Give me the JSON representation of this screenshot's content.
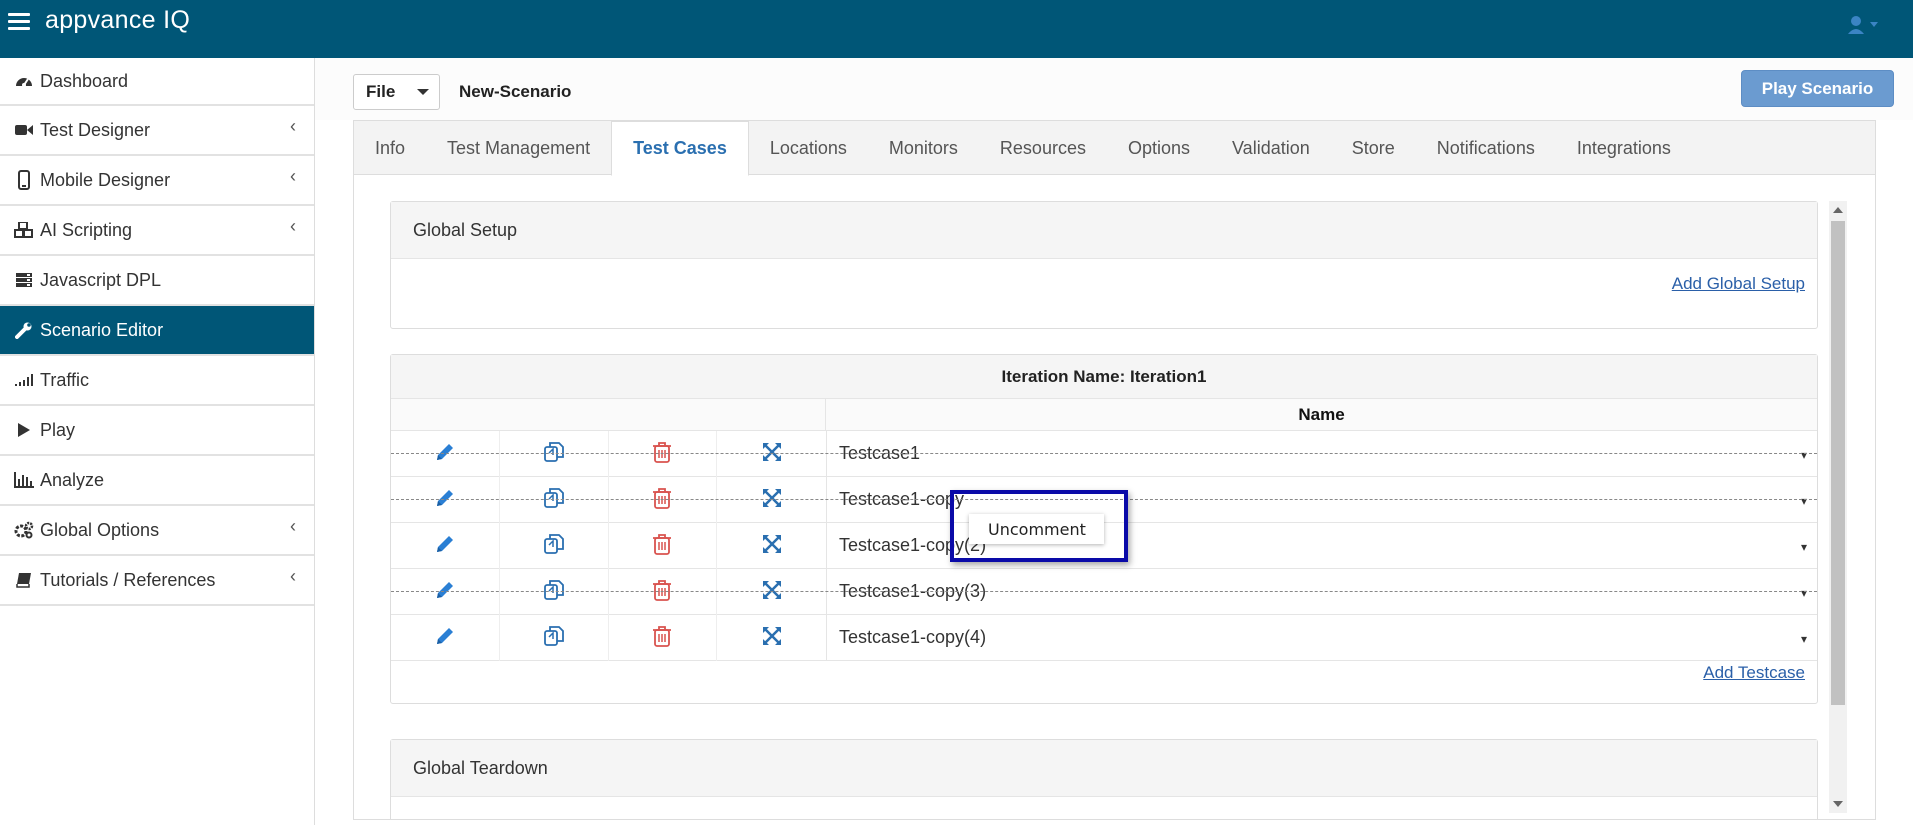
{
  "app": {
    "logo": "appvance IQ"
  },
  "sidebar": {
    "items": [
      {
        "label": "Dashboard",
        "icon": "dashboard-icon"
      },
      {
        "label": "Test Designer",
        "icon": "video-camera-icon",
        "chevron": "‹"
      },
      {
        "label": "Mobile Designer",
        "icon": "mobile-icon",
        "chevron": "‹"
      },
      {
        "label": "AI Scripting",
        "icon": "cubes-icon",
        "chevron": "‹"
      },
      {
        "label": "Javascript DPL",
        "icon": "server-icon"
      },
      {
        "label": "Scenario Editor",
        "icon": "wrench-icon",
        "active": true
      },
      {
        "label": "Traffic",
        "icon": "signal-icon"
      },
      {
        "label": "Play",
        "icon": "play-icon"
      },
      {
        "label": "Analyze",
        "icon": "bar-chart-icon"
      },
      {
        "label": "Global Options",
        "icon": "cogs-icon",
        "chevron": "‹"
      },
      {
        "label": "Tutorials / References",
        "icon": "book-icon",
        "chevron": "‹"
      }
    ]
  },
  "toolbar": {
    "file_label": "File",
    "scenario_name": "New-Scenario",
    "play_label": "Play Scenario"
  },
  "tabs": [
    "Info",
    "Test Management",
    "Test Cases",
    "Locations",
    "Monitors",
    "Resources",
    "Options",
    "Validation",
    "Store",
    "Notifications",
    "Integrations"
  ],
  "active_tab": "Test Cases",
  "global_setup": {
    "title": "Global Setup",
    "add_link": "Add Global Setup"
  },
  "iteration": {
    "title": "Iteration Name: Iteration1",
    "name_header": "Name",
    "testcases": [
      {
        "name": "Testcase1",
        "commented": true
      },
      {
        "name": "Testcase1-copy",
        "commented": true
      },
      {
        "name": "Testcase1-copy(2)",
        "commented": false
      },
      {
        "name": "Testcase1-copy(3)",
        "commented": true
      },
      {
        "name": "Testcase1-copy(4)",
        "commented": false
      }
    ],
    "dropdown_glyph": "▾",
    "add_link": "Add Testcase"
  },
  "global_teardown": {
    "title": "Global Teardown"
  },
  "context_menu": {
    "item": "Uncomment"
  },
  "colors": {
    "brand": "#005677",
    "action_icon_blue": "#2a7fd4",
    "delete_red": "#d9534f",
    "play_button": "#6b9bd0"
  }
}
